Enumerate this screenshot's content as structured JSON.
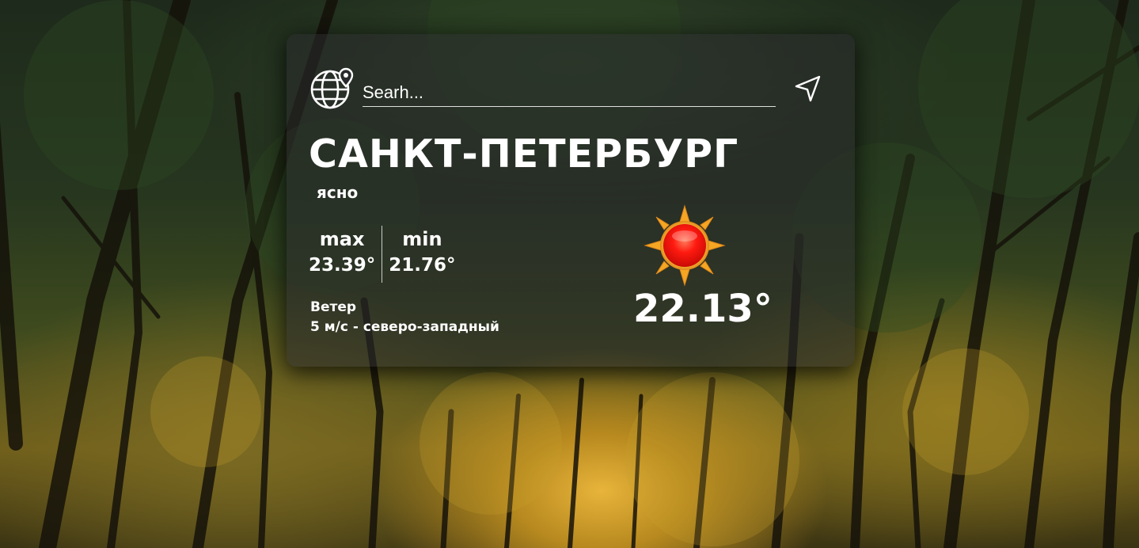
{
  "search": {
    "placeholder": "Searh..."
  },
  "weather": {
    "city": "САНКТ-ПЕТЕРБУРГ",
    "description": "ясно",
    "max_label": "max",
    "max_value": "23.39°",
    "min_label": "min",
    "min_value": "21.76°",
    "wind_label": "Ветер",
    "wind_value": "5 м/с - северо-западный",
    "temperature": "22.13°",
    "condition_icon": "sun-icon"
  },
  "icons": {
    "globe": "globe-pin-icon",
    "locate": "navigation-arrow-icon"
  },
  "colors": {
    "text": "#ffffff",
    "card": "#28282c",
    "sun_core": "#ff1a10",
    "sun_rays": "#f5a623"
  }
}
